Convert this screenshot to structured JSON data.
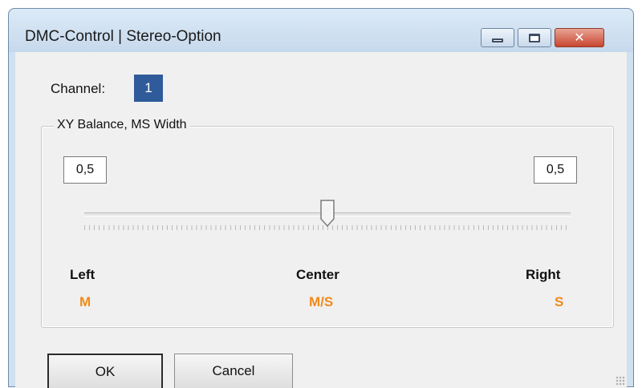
{
  "window": {
    "title": "DMC-Control | Stereo-Option",
    "minimize_icon": "minimize-icon",
    "maximize_icon": "maximize-icon",
    "close_icon": "close-icon",
    "close_glyph": "✕"
  },
  "channel": {
    "label": "Channel:",
    "value": "1",
    "highlight_color": "#2f5b9a"
  },
  "group": {
    "title": "XY Balance, MS Width",
    "left_value": "0,5",
    "right_value": "0,5",
    "slider_position": 0.5
  },
  "scale": {
    "left_label": "Left",
    "left_sub": "M",
    "center_label": "Center",
    "center_sub": "M/S",
    "right_label": "Right",
    "right_sub": "S",
    "sub_color": "#f08a1a"
  },
  "buttons": {
    "ok": "OK",
    "cancel": "Cancel"
  }
}
